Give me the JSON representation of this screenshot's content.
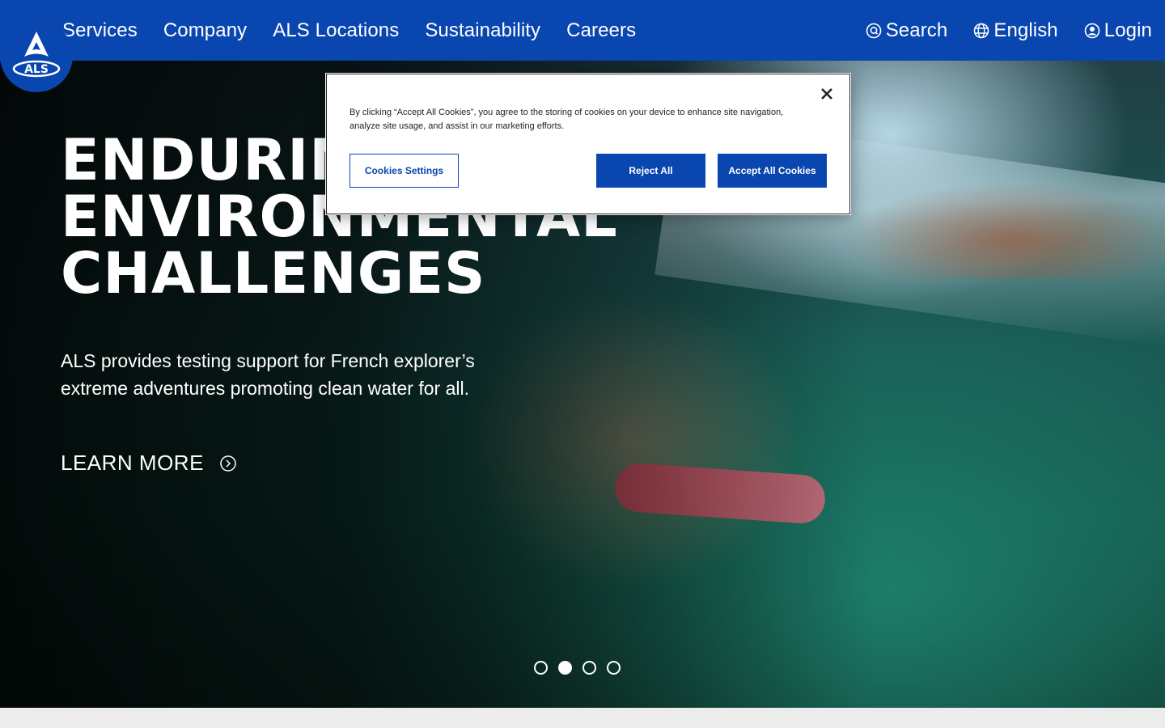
{
  "header": {
    "logo_text": "ALS",
    "nav": [
      {
        "label": "Services"
      },
      {
        "label": "Company"
      },
      {
        "label": "ALS Locations"
      },
      {
        "label": "Sustainability"
      },
      {
        "label": "Careers"
      }
    ],
    "utility": {
      "search_label": "Search",
      "language_label": "English",
      "login_label": "Login"
    }
  },
  "hero": {
    "title_lines": [
      "ENDURING",
      "ENVIRONMENTAL",
      "CHALLENGES"
    ],
    "subtitle": "ALS provides testing support for French explorer’s extreme adventures promoting clean water for all.",
    "cta_label": "LEARN MORE",
    "slides": 4,
    "active_slide": 2
  },
  "cookie_banner": {
    "message": "By clicking “Accept All Cookies”, you agree to the storing of cookies on your device to enhance site navigation, analyze site usage, and assist in our marketing efforts.",
    "settings_label": "Cookies Settings",
    "reject_label": "Reject All",
    "accept_label": "Accept All Cookies"
  },
  "colors": {
    "brand_blue": "#0a46b0",
    "white": "#ffffff"
  },
  "icons": [
    "als-logo",
    "search-icon",
    "globe-icon",
    "user-icon",
    "chevron-right-circle-icon",
    "close-icon"
  ]
}
